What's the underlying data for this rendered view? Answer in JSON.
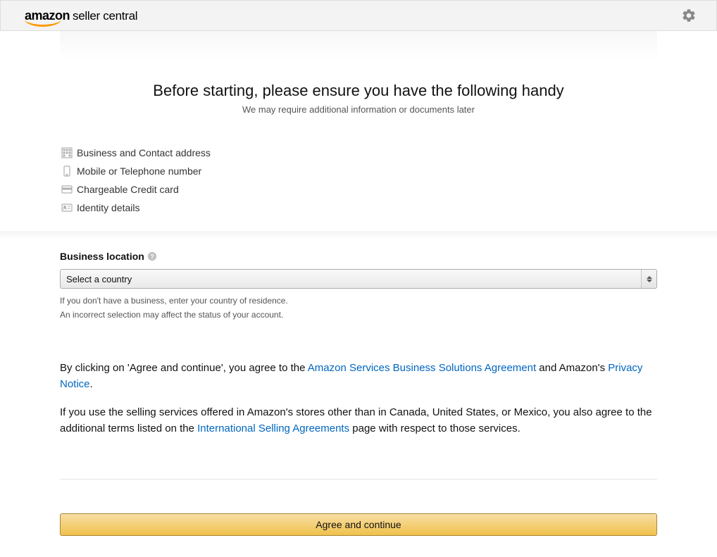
{
  "header": {
    "logo_primary": "amazon",
    "logo_secondary": "seller central"
  },
  "intro": {
    "title": "Before starting, please ensure you have the following handy",
    "subtitle": "We may require additional information or documents later"
  },
  "requirements": [
    {
      "icon": "building-icon",
      "label": "Business and Contact address"
    },
    {
      "icon": "phone-icon",
      "label": "Mobile or Telephone number"
    },
    {
      "icon": "credit-card-icon",
      "label": "Chargeable Credit card"
    },
    {
      "icon": "id-card-icon",
      "label": "Identity details"
    }
  ],
  "location_field": {
    "label": "Business location",
    "placeholder": "Select a country",
    "helper_line1": "If you don't have a business, enter your country of residence.",
    "helper_line2": "An incorrect selection may affect the status of your account."
  },
  "agreement": {
    "para1_prefix": "By clicking on 'Agree and continue', you agree to the ",
    "link1": "Amazon Services Business Solutions Agreement",
    "para1_mid": " and Amazon's ",
    "link2": "Privacy Notice",
    "para1_suffix": ".",
    "para2_prefix": "If you use the selling services offered in Amazon's stores other than in Canada, United States, or Mexico, you also agree to the additional terms listed on the ",
    "link3": "International Selling Agreements",
    "para2_suffix": " page with respect to those services."
  },
  "button": {
    "agree_label": "Agree and continue"
  }
}
